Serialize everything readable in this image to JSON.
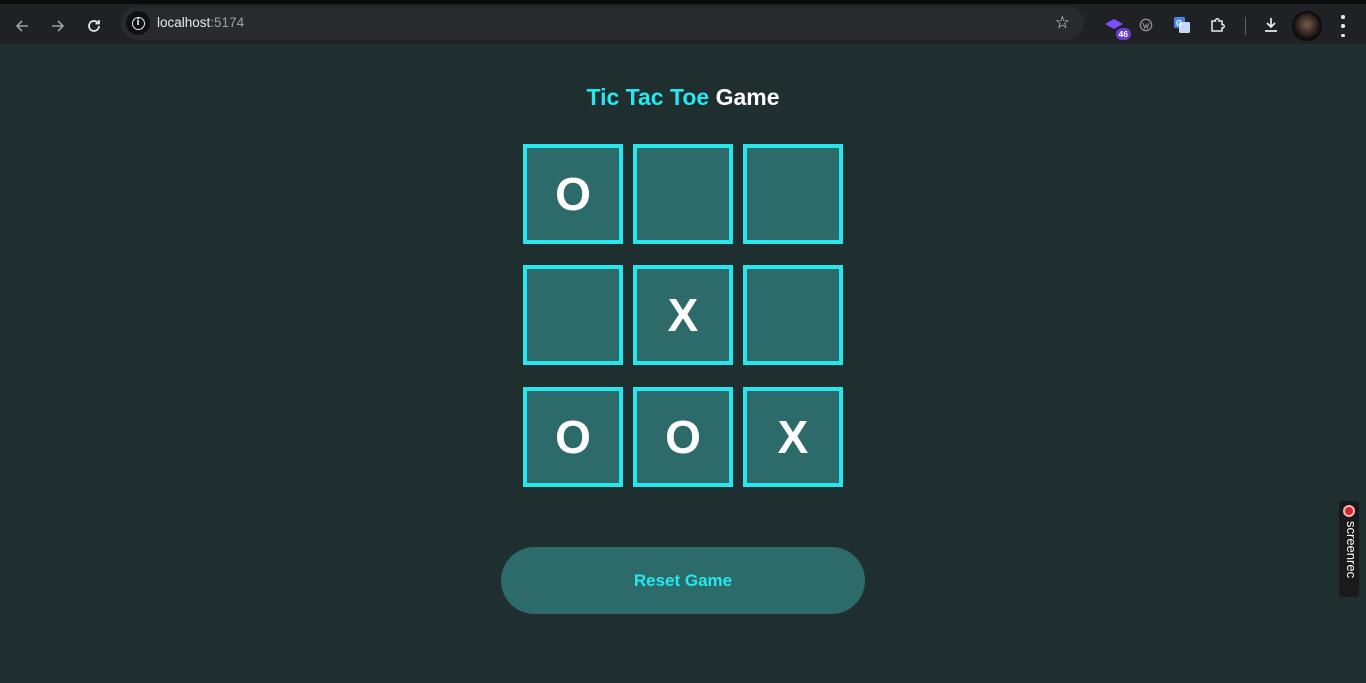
{
  "browser": {
    "url_host": "localhost",
    "url_port": ":5174",
    "extension_badge": "46"
  },
  "page": {
    "title_accent": "Tic Tac Toe",
    "title_rest": "Game",
    "reset_label": "Reset Game"
  },
  "board": {
    "cells": [
      "O",
      "",
      "",
      "",
      "X",
      "",
      "O",
      "O",
      "X"
    ]
  },
  "overlay": {
    "recorder_label": "screenrec"
  },
  "colors": {
    "background": "#1f2e2f",
    "accent": "#26e7ee",
    "cell_fill": "#2d6b6b",
    "mark": "#ffffff"
  }
}
